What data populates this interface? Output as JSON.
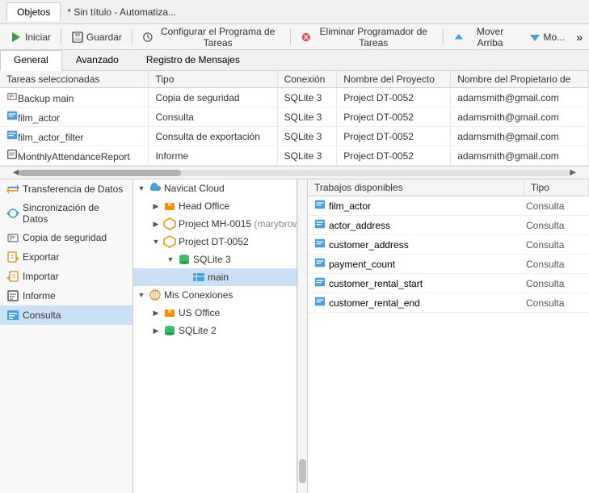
{
  "titlebar": {
    "tab": "Objetos",
    "title": "* Sin título - Automatiza..."
  },
  "toolbar": {
    "iniciar": "Iniciar",
    "guardar": "Guardar",
    "configurar": "Configurar el Programa de Tareas",
    "eliminar": "Eliminar Programador de Tareas",
    "mover_arriba": "Mover Arriba",
    "mover_abajo": "Mo..."
  },
  "tabs": [
    {
      "label": "General",
      "active": true
    },
    {
      "label": "Avanzado",
      "active": false
    },
    {
      "label": "Registro de Mensajes",
      "active": false
    }
  ],
  "table": {
    "headers": [
      "Tareas seleccionadas",
      "Tipo",
      "Conexión",
      "Nombre del Proyecto",
      "Nombre del Propietario de"
    ],
    "rows": [
      {
        "icon": "backup",
        "name": "Backup main",
        "tipo": "Copia de seguridad",
        "conexion": "SQLite 3",
        "proyecto": "Project DT-0052",
        "propietario": "adamsmith@gmail.com"
      },
      {
        "icon": "query",
        "name": "film_actor",
        "tipo": "Consulta",
        "conexion": "SQLite 3",
        "proyecto": "Project DT-0052",
        "propietario": "adamsmith@gmail.com"
      },
      {
        "icon": "query",
        "name": "film_actor_filter",
        "tipo": "Consulta de exportación",
        "conexion": "SQLite 3",
        "proyecto": "Project DT-0052",
        "propietario": "adamsmith@gmail.com"
      },
      {
        "icon": "report",
        "name": "MonthlyAttendanceReport",
        "tipo": "Informe",
        "conexion": "SQLite 3",
        "proyecto": "Project DT-0052",
        "propietario": "adamsmith@gmail.com"
      }
    ]
  },
  "sidebar": {
    "items": [
      {
        "label": "Transferencia de Datos",
        "icon": "transfer-icon"
      },
      {
        "label": "Sincronización de Datos",
        "icon": "sync-icon"
      },
      {
        "label": "Copia de seguridad",
        "icon": "backup-icon"
      },
      {
        "label": "Exportar",
        "icon": "export-icon"
      },
      {
        "label": "Importar",
        "icon": "import-icon"
      },
      {
        "label": "Informe",
        "icon": "report-icon"
      },
      {
        "label": "Consulta",
        "icon": "query-icon",
        "active": true
      }
    ]
  },
  "tree": {
    "items": [
      {
        "level": 0,
        "expanded": true,
        "label": "Navicat Cloud",
        "icon": "cloud-icon"
      },
      {
        "level": 1,
        "expanded": false,
        "label": "Head Office",
        "icon": "office-icon"
      },
      {
        "level": 1,
        "expanded": true,
        "label": "Project MH-0015",
        "suffix": "(marybrow",
        "icon": "project-icon"
      },
      {
        "level": 1,
        "expanded": true,
        "label": "Project DT-0052",
        "icon": "project-icon"
      },
      {
        "level": 2,
        "expanded": true,
        "label": "SQLite 3",
        "icon": "sqlite-icon"
      },
      {
        "level": 3,
        "expanded": false,
        "label": "main",
        "icon": "main-icon",
        "active": true
      },
      {
        "level": 0,
        "expanded": true,
        "label": "Mis Conexiones",
        "icon": "connections-icon"
      },
      {
        "level": 1,
        "expanded": false,
        "label": "US Office",
        "icon": "office2-icon"
      },
      {
        "level": 1,
        "expanded": false,
        "label": "SQLite 2",
        "icon": "sqlite2-icon"
      }
    ]
  },
  "jobs": {
    "col_trabajos": "Trabajos disponibles",
    "col_tipo": "Tipo",
    "rows": [
      {
        "name": "film_actor",
        "tipo": "Consulta"
      },
      {
        "name": "actor_address",
        "tipo": "Consulta"
      },
      {
        "name": "customer_address",
        "tipo": "Consulta"
      },
      {
        "name": "payment_count",
        "tipo": "Consulta"
      },
      {
        "name": "customer_rental_start",
        "tipo": "Consulta"
      },
      {
        "name": "customer_rental_end",
        "tipo": "Consulta"
      }
    ]
  }
}
